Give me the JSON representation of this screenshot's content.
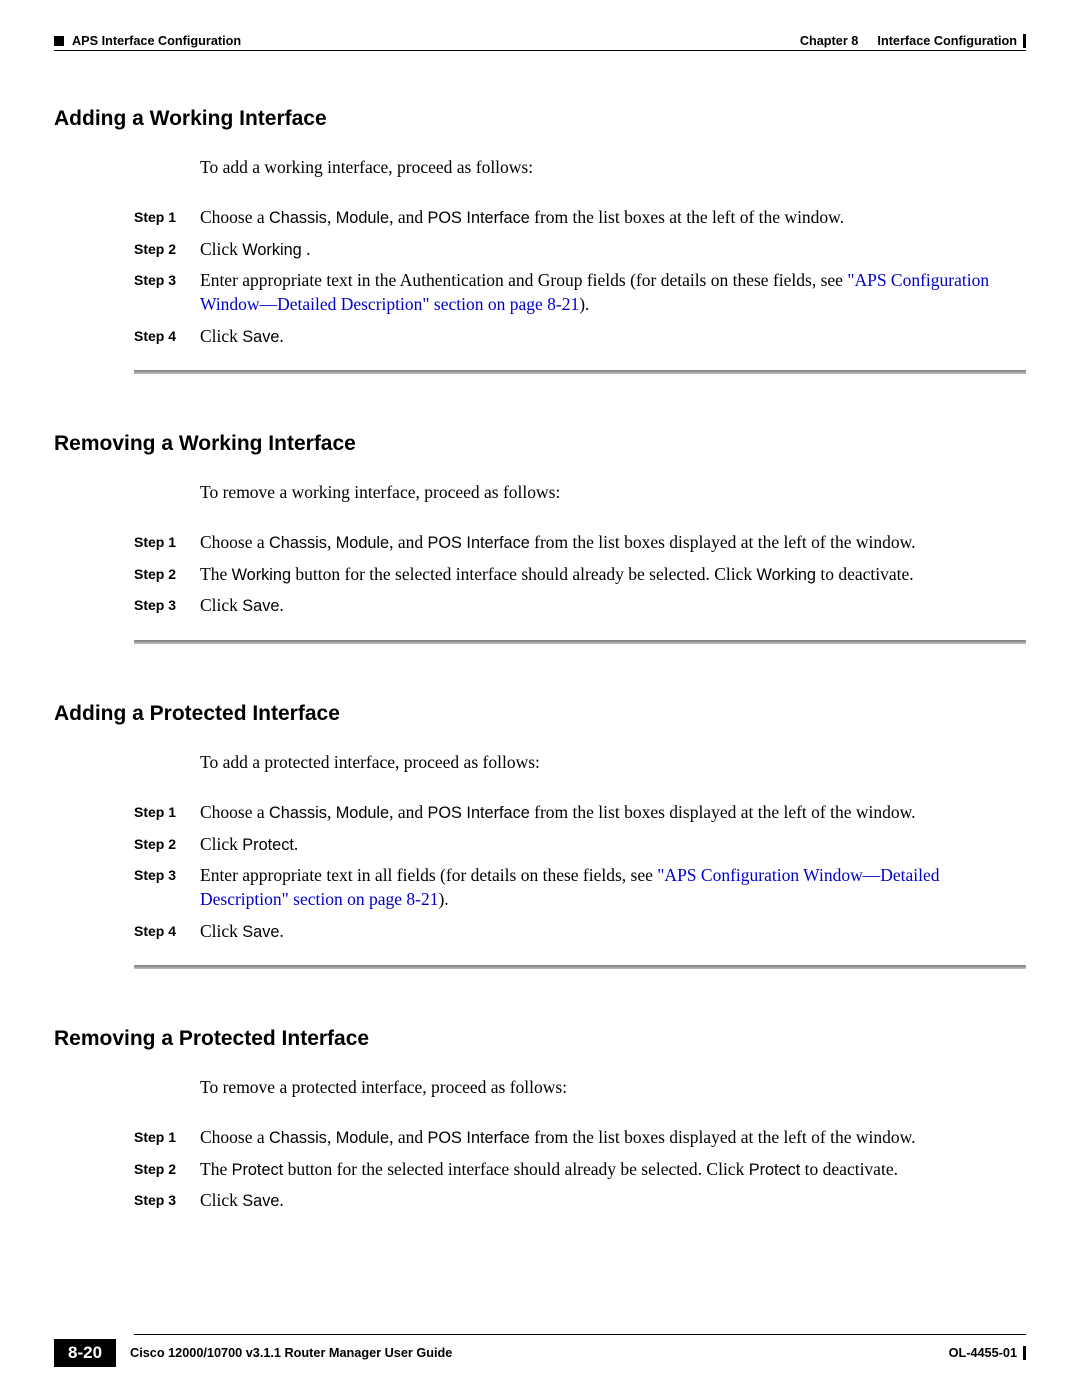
{
  "header": {
    "left": "APS Interface Configuration",
    "right_chapter": "Chapter 8",
    "right_title": "Interface Configuration"
  },
  "sections": {
    "s1": {
      "title": "Adding a Working Interface",
      "intro": "To add a working interface, proceed as follows:",
      "steps": {
        "l1": "Step 1",
        "l2": "Step 2",
        "l3": "Step 3",
        "l4": "Step 4",
        "t1a": "Choose a ",
        "t1b": "Chassis",
        "t1c": ", ",
        "t1d": "Module",
        "t1e": ", and ",
        "t1f": "POS Interface",
        "t1g": " from the list boxes at the left of the window.",
        "t2a": "Click ",
        "t2b": "Working",
        "t2c": " .",
        "t3a": "Enter appropriate text in the Authentication and Group fields (for details on these fields, see ",
        "t3b": "\"APS Configuration Window—Detailed Description\" section on page 8-21",
        "t3c": ").",
        "t4a": "Click ",
        "t4b": "Save",
        "t4c": "."
      }
    },
    "s2": {
      "title": "Removing a Working Interface",
      "intro": "To remove a working interface, proceed as follows:",
      "steps": {
        "l1": "Step 1",
        "l2": "Step 2",
        "l3": "Step 3",
        "t1a": "Choose a ",
        "t1b": "Chassis",
        "t1c": ", ",
        "t1d": "Module",
        "t1e": ", and ",
        "t1f": "POS Interface",
        "t1g": " from the list boxes displayed at the left of the window.",
        "t2a": "The ",
        "t2b": "Working",
        "t2c": " button for the selected interface should already be selected. Click ",
        "t2d": "Working",
        "t2e": " to deactivate.",
        "t3a": "Click ",
        "t3b": "Save",
        "t3c": "."
      }
    },
    "s3": {
      "title": "Adding a Protected Interface",
      "intro": "To add a protected interface, proceed as follows:",
      "steps": {
        "l1": "Step 1",
        "l2": "Step 2",
        "l3": "Step 3",
        "l4": "Step 4",
        "t1a": "Choose a ",
        "t1b": "Chassis",
        "t1c": ", ",
        "t1d": "Module",
        "t1e": ", and ",
        "t1f": "POS Interface",
        "t1g": " from the list boxes displayed at the left of the window.",
        "t2a": "Click ",
        "t2b": "Protect",
        "t2c": ".",
        "t3a": "Enter appropriate text in all fields (for details on these fields, see ",
        "t3b": "\"APS Configuration Window—Detailed Description\" section on page 8-21",
        "t3c": ").",
        "t4a": "Click ",
        "t4b": "Save",
        "t4c": "."
      }
    },
    "s4": {
      "title": "Removing a Protected Interface",
      "intro": "To remove a protected interface, proceed as follows:",
      "steps": {
        "l1": "Step 1",
        "l2": "Step 2",
        "l3": "Step 3",
        "t1a": "Choose a ",
        "t1b": "Chassis",
        "t1c": ", ",
        "t1d": "Module",
        "t1e": ", and ",
        "t1f": "POS Interface",
        "t1g": " from the list boxes displayed at the left of the window.",
        "t2a": "The ",
        "t2b": "Protect",
        "t2c": " button for the selected interface should already be selected. Click ",
        "t2d": "Protect",
        "t2e": " to deactivate.",
        "t3a": "Click ",
        "t3b": "Save",
        "t3c": "."
      }
    }
  },
  "footer": {
    "guide": "Cisco 12000/10700 v3.1.1 Router Manager User Guide",
    "page": "8-20",
    "docid": "OL-4455-01"
  }
}
